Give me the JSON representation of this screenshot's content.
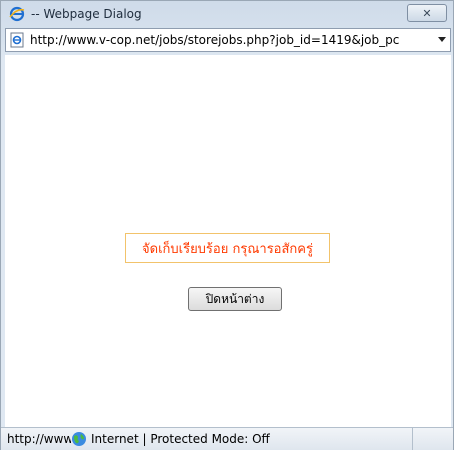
{
  "window": {
    "title": "-- Webpage Dialog",
    "close_label": "✕"
  },
  "address": {
    "url": "http://www.v-cop.net/jobs/storejobs.php?job_id=1419&job_pc"
  },
  "content": {
    "message": "จัดเก็บเรียบร้อย กรุณารอสักครู่",
    "close_window_button": "ปิดหน้าต่าง"
  },
  "status": {
    "url_fragment": "http://www.v",
    "zone": "Internet | Protected Mode: Off"
  },
  "colors": {
    "message_text": "#ff3a00",
    "message_border": "#f2c36b"
  },
  "icons": {
    "title": "ie-icon",
    "address": "page-icon",
    "zone": "globe-icon"
  }
}
